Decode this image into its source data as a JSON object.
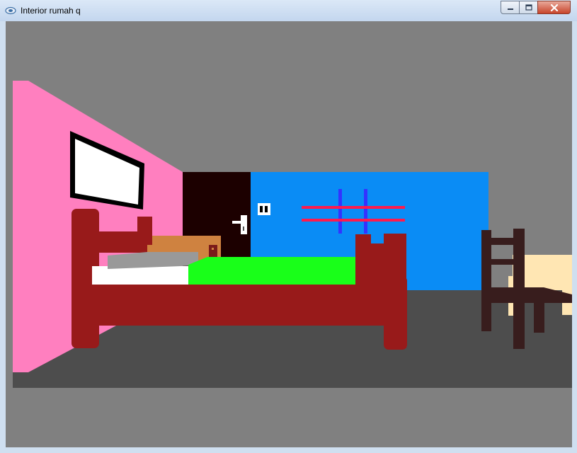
{
  "window": {
    "title": "Interior rumah q",
    "controls": {
      "minimize_icon": "minimize-icon",
      "maximize_icon": "maximize-icon",
      "close_icon": "close-icon"
    }
  },
  "scene": {
    "colors": {
      "background": "#808080",
      "floor": "#4d4d4d",
      "left_wall": "#ff7fbf",
      "back_wall": "#0a8cf5",
      "doorway": "#1c0000",
      "bed_frame": "#981a1a",
      "blanket": "#19ff19",
      "sheet": "#ffffff",
      "pillow": "#999999",
      "cabinet": "#cf8240",
      "chair": "#381d1d",
      "table": "#ffe6b3",
      "window_bars_horizontal": "#ff1a4d",
      "window_bars_vertical": "#3333ff"
    }
  }
}
